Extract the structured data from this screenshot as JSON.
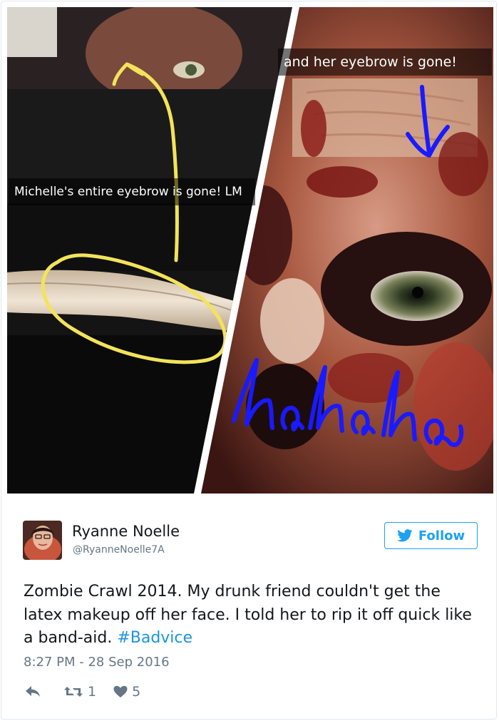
{
  "media": {
    "caption_left": "Michelle's entire eyebrow is gone! LM",
    "caption_right": "and her eyebrow is gone!",
    "doodle_text": "hahaha"
  },
  "author": {
    "name": "Ryanne Noelle",
    "handle": "@RyanneNoelle7A"
  },
  "follow_label": "Follow",
  "tweet": {
    "text": "Zombie Crawl 2014. My drunk friend couldn't get the latex makeup off her face. I told her to rip it off quick like a band-aid. ",
    "hashtag": "#Badvice",
    "timestamp": "8:27 PM - 28 Sep 2016"
  },
  "actions": {
    "retweet_count": "1",
    "like_count": "5"
  },
  "colors": {
    "accent": "#1da1f2",
    "hashtag": "#1b95e0",
    "muted": "#657786",
    "doodle_yellow": "#f3e35a",
    "doodle_blue": "#1a1aff"
  }
}
